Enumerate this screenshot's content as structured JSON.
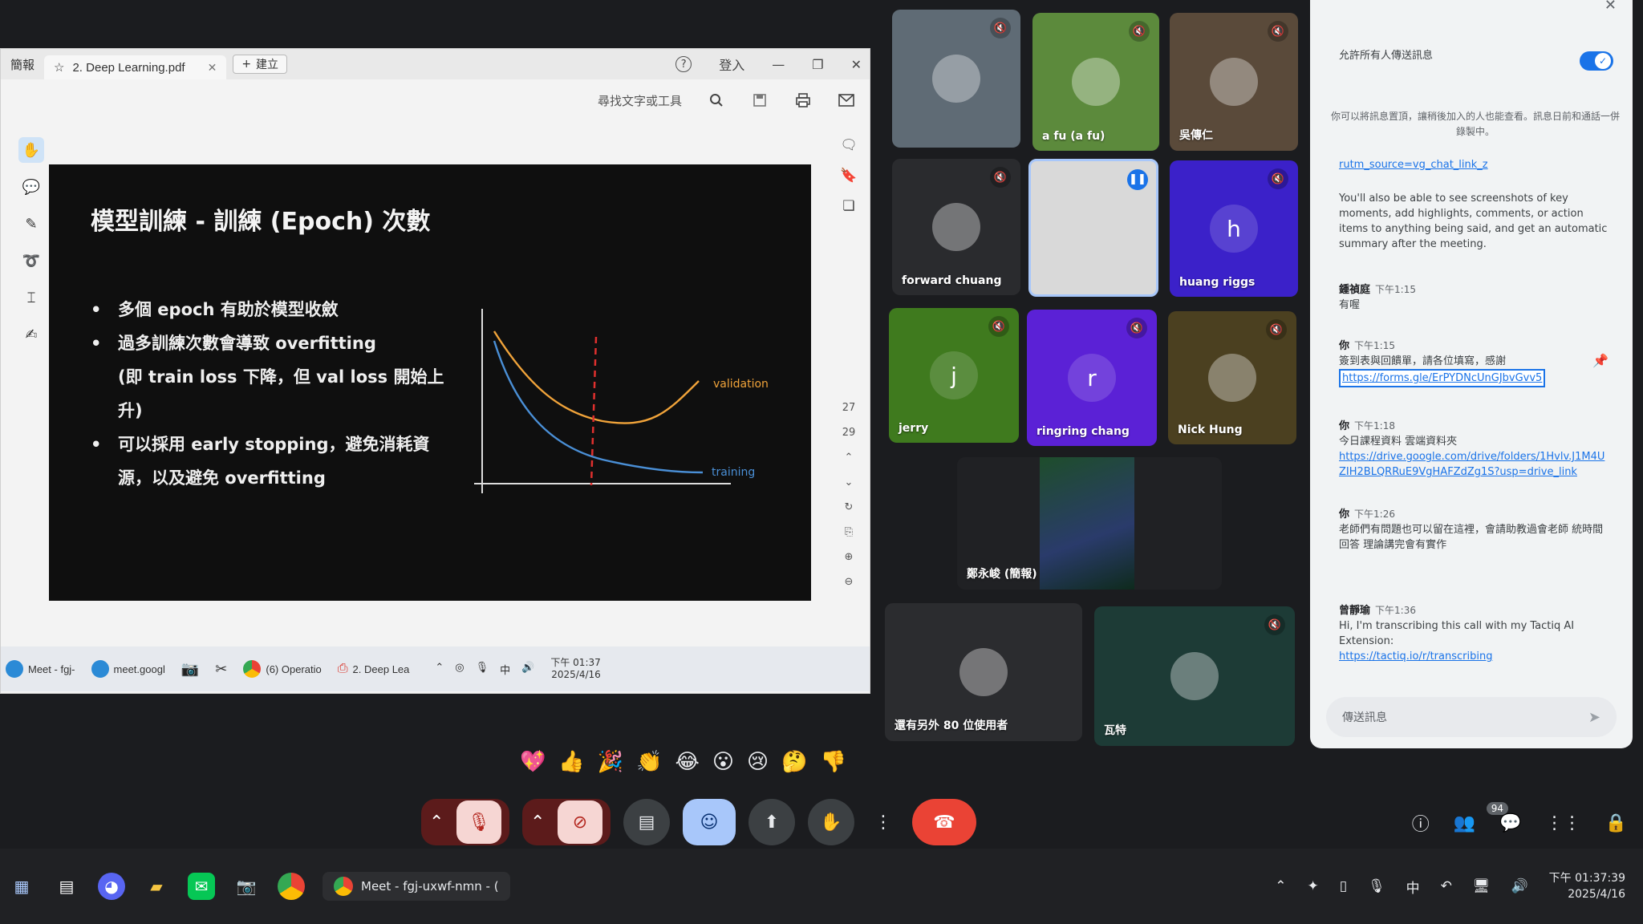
{
  "pdf_window": {
    "tabs": [
      {
        "label": "簡報"
      },
      {
        "label": "2. Deep Learning.pdf"
      }
    ],
    "new_tab_label": "建立",
    "help_label": "?",
    "signin_label": "登入",
    "search_tools_label": "尋找文字或工具",
    "page_numbers": [
      "27",
      "29"
    ]
  },
  "slide": {
    "title": "模型訓練 - 訓練 (Epoch) 次數",
    "bullets": [
      "多個 epoch 有助於模型收斂",
      "過多訓練次數會導致 overfitting",
      "(即 train loss 下降，但 val loss 開始上",
      "升)",
      "可以採用 early stopping，避免消耗資",
      "源，以及避免 overfitting"
    ],
    "chart_data": {
      "type": "line",
      "series": [
        {
          "name": "validation",
          "color": "#f0a33a"
        },
        {
          "name": "training",
          "color": "#4a8fd6"
        }
      ],
      "annotation": "dashed vertical line at early-stopping point",
      "annotation_color": "#e0302e"
    }
  },
  "shared_taskbar": {
    "items": [
      "Meet - fgj-",
      "meet.googl",
      "(6) Operatio",
      "2. Deep Lea"
    ],
    "tray_ime": "中",
    "time": "下午 01:37",
    "date": "2025/4/16"
  },
  "participants": [
    {
      "name": "",
      "color": "#5f6b75",
      "muted": true
    },
    {
      "name": "a fu (a fu)",
      "color": "#5c8a3c",
      "muted": true
    },
    {
      "name": "吳傳仁",
      "color": "#5a4a3a",
      "muted": true
    },
    {
      "name": "forward chuang",
      "color": "#2a2b2e",
      "muted": true
    },
    {
      "name": "",
      "color": "#d9d9d9",
      "muted": false,
      "speaking": true
    },
    {
      "name": "huang riggs",
      "color": "#3b21c9",
      "muted": true,
      "initial": "h"
    },
    {
      "name": "jerry",
      "color": "#3f7a1e",
      "muted": true,
      "initial": "j"
    },
    {
      "name": "ringring chang",
      "color": "#5b21d6",
      "muted": true,
      "initial": "r"
    },
    {
      "name": "Nick Hung",
      "color": "#4b4020",
      "muted": true
    },
    {
      "name": "鄭永峻 (簡報)",
      "color": "#202124",
      "presenting": true
    },
    {
      "name": "還有另外 80 位使用者",
      "color": "#2b2c2f"
    },
    {
      "name": "瓦特",
      "color": "#1d3b36",
      "muted": true
    }
  ],
  "reactions": [
    "💖",
    "👍",
    "🎉",
    "👏",
    "😂",
    "😮",
    "😢",
    "🤔",
    "👎"
  ],
  "controls": {
    "mic_icon": "mic-off-icon",
    "camera_icon": "camera-off-icon",
    "captions_icon": "captions-icon",
    "emoji_icon": "emoji-icon",
    "present_icon": "present-icon",
    "hand_icon": "raise-hand-icon",
    "more_icon": "more-icon",
    "end_icon": "end-call-icon",
    "people_count": "94"
  },
  "chat": {
    "allow_label": "允許所有人傳送訊息",
    "notice": "你可以將訊息置頂，讓稍後加入的人也能查看。訊息日前和通話一併錄製中。",
    "utm_link": "rutm_source=vg_chat_link_z",
    "info_text": "You'll also be able to see screenshots of key moments, add highlights, comments, or action items to anything being said, and get an automatic summary after the meeting.",
    "messages": [
      {
        "sender": "鍾禎庭",
        "time": "下午1:15",
        "text": "有喔",
        "link": ""
      },
      {
        "sender": "你",
        "time": "下午1:15",
        "text": "簽到表與回饋單，請各位填寫，感謝",
        "link": "https://forms.gle/ErPYDNcUnGJbvGvv5"
      },
      {
        "sender": "你",
        "time": "下午1:18",
        "text": "今日課程資料 雲端資料夾",
        "link": "https://drive.google.com/drive/folders/1Hvlv.J1M4U ZIH2BLQRRuE9VgHAFZdZg1S?usp=drive_link"
      },
      {
        "sender": "你",
        "time": "下午1:26",
        "text": "老師們有問題也可以留在這裡，會請助教過會老師 統時間回答 理論講完會有實作",
        "link": ""
      },
      {
        "sender": "曾靜瑜",
        "time": "下午1:36",
        "text": "Hi, I'm transcribing this call with my Tactiq AI Extension:",
        "link": "https://tactiq.io/r/transcribing"
      }
    ],
    "input_placeholder": "傳送訊息"
  },
  "host_taskbar": {
    "active_window": "Meet - fgj-uxwf-nmn - (",
    "ime": "中",
    "time": "下午 01:37:39",
    "date": "2025/4/16"
  }
}
